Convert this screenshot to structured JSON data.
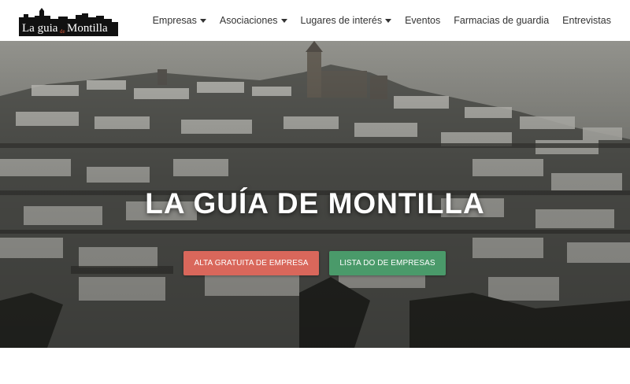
{
  "brand": {
    "logo_part1": "La guia",
    "logo_part2": "de",
    "logo_part3": "Montilla"
  },
  "nav": {
    "items": [
      {
        "label": "Empresas",
        "dropdown": true
      },
      {
        "label": "Asociaciones",
        "dropdown": true
      },
      {
        "label": "Lugares de interés",
        "dropdown": true
      },
      {
        "label": "Eventos",
        "dropdown": false
      },
      {
        "label": "Farmacias de guardia",
        "dropdown": false
      },
      {
        "label": "Entrevistas",
        "dropdown": false
      }
    ]
  },
  "hero": {
    "title": "LA GUÍA DE MONTILLA",
    "primary_button": "ALTA GRATUITA DE EMPRESA",
    "secondary_button": "LISTA DO DE EMPRESAS"
  },
  "colors": {
    "primary_button": "#d9675b",
    "secondary_button": "#4a9a6a",
    "nav_text": "#333333"
  }
}
